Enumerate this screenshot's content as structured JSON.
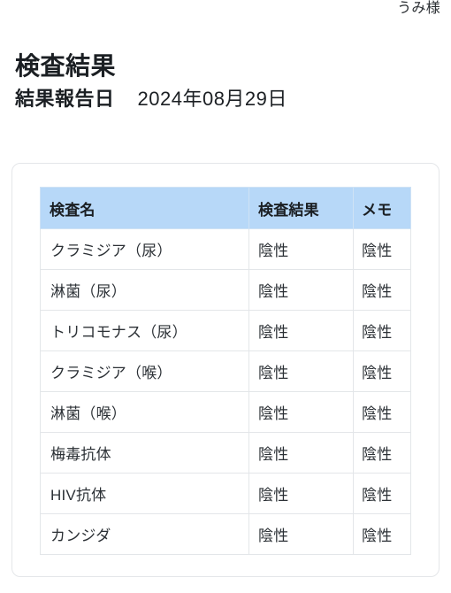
{
  "header": {
    "user_name": "うみ様"
  },
  "page_title": "検査結果",
  "report": {
    "label": "結果報告日",
    "date": "2024年08月29日"
  },
  "table": {
    "columns": [
      {
        "key": "name",
        "label": "検査名"
      },
      {
        "key": "result",
        "label": "検査結果"
      },
      {
        "key": "memo",
        "label": "メモ"
      }
    ],
    "rows": [
      {
        "name": "クラミジア（尿）",
        "result": "陰性",
        "memo": "陰性"
      },
      {
        "name": "淋菌（尿）",
        "result": "陰性",
        "memo": "陰性"
      },
      {
        "name": "トリコモナス（尿）",
        "result": "陰性",
        "memo": "陰性"
      },
      {
        "name": "クラミジア（喉）",
        "result": "陰性",
        "memo": "陰性"
      },
      {
        "name": "淋菌（喉）",
        "result": "陰性",
        "memo": "陰性"
      },
      {
        "name": "梅毒抗体",
        "result": "陰性",
        "memo": "陰性"
      },
      {
        "name": "HIV抗体",
        "result": "陰性",
        "memo": "陰性"
      },
      {
        "name": "カンジダ",
        "result": "陰性",
        "memo": "陰性"
      }
    ]
  },
  "colors": {
    "page_background": "#ffffff",
    "table_header_background": "#b7d8f8",
    "table_border": "#e3e6e9",
    "card_border": "#e4e6e9",
    "text_primary": "#1b1f23",
    "text_cell": "#2c3136"
  }
}
